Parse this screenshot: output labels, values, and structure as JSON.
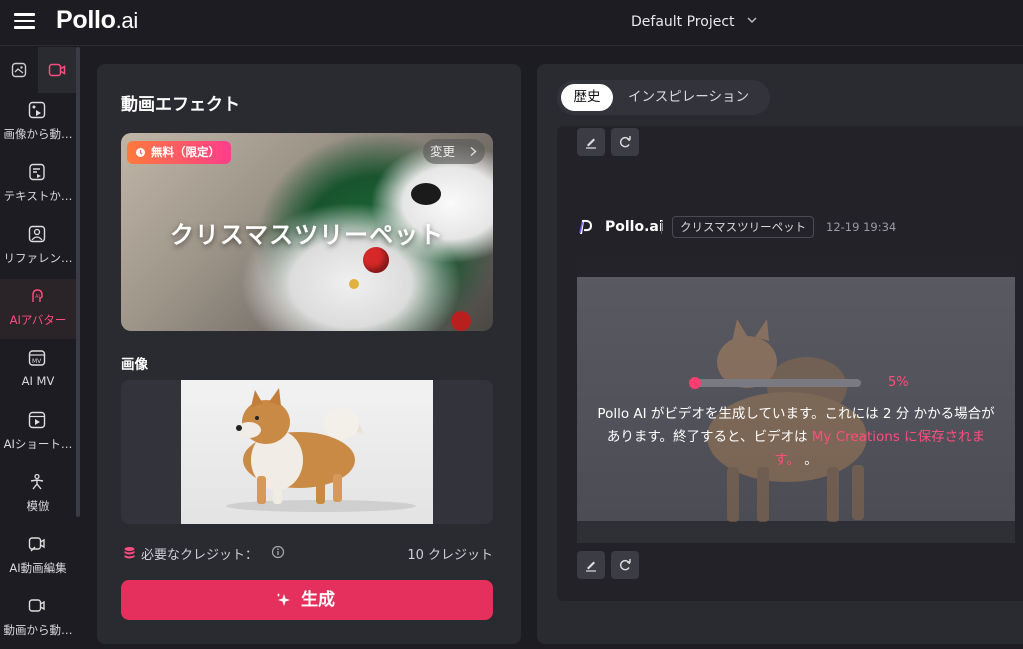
{
  "header": {
    "logo_main": "Pollo",
    "logo_suffix": ".ai",
    "project": "Default Project"
  },
  "sidebar": {
    "tabs": [
      {
        "icon": "image-icon"
      },
      {
        "icon": "video-icon",
        "active": true
      }
    ],
    "items": [
      {
        "label": "画像から動…",
        "icon": "image-to-video-icon"
      },
      {
        "label": "テキストか…",
        "icon": "text-to-video-icon"
      },
      {
        "label": "リファレン…",
        "icon": "reference-icon"
      },
      {
        "label": "AIアバター",
        "icon": "avatar-icon",
        "active": true
      },
      {
        "label": "AI MV",
        "icon": "mv-icon"
      },
      {
        "label": "AIショート…",
        "icon": "short-video-icon"
      },
      {
        "label": "模倣",
        "icon": "imitate-icon"
      },
      {
        "label": "AI動画編集",
        "icon": "video-edit-icon"
      },
      {
        "label": "動画から動…",
        "icon": "video-to-video-icon"
      }
    ]
  },
  "left_panel": {
    "title": "動画エフェクト",
    "effect": {
      "badge": "無料（限定）",
      "change_label": "変更",
      "name": "クリスマスツリーペット"
    },
    "image_label": "画像",
    "credits_label": "必要なクレジット：",
    "credits_value": "10 クレジット",
    "generate_label": "生成"
  },
  "right_panel": {
    "tabs": [
      {
        "label": "歴史",
        "active": true
      },
      {
        "label": "インスピレーション",
        "active": false
      }
    ],
    "job": {
      "brand": "Pollo.ai",
      "tag": "クリスマスツリーペット",
      "time": "12-19 19:34",
      "progress_percent": 5,
      "progress_label": "5%",
      "message_part1": "Pollo AI がビデオを生成しています。これには 2 分 かかる場合があります。終了すると、ビデオは ",
      "message_link": "My Creations に保存されます。",
      "message_end": " 。"
    }
  },
  "colors": {
    "accent": "#e5305d",
    "accent_text": "#ff4d7d",
    "background": "#1c1c22",
    "panel": "#2a2a31"
  }
}
